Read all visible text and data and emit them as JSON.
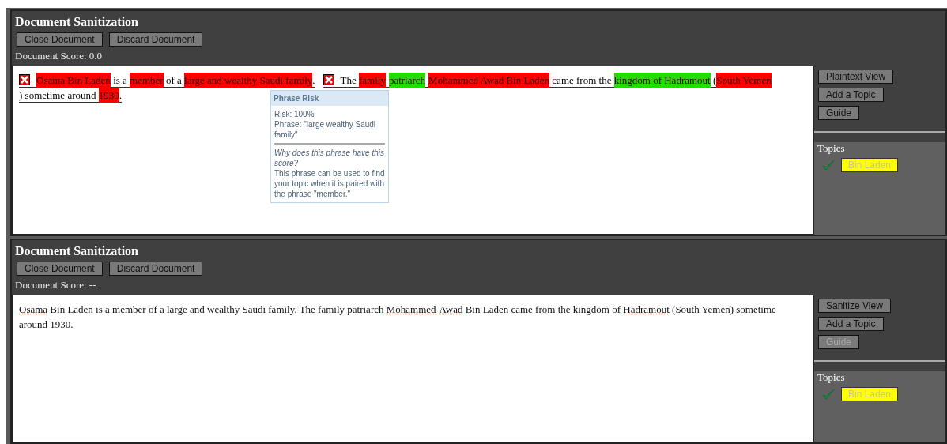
{
  "panels": [
    {
      "title": "Document Sanitization",
      "buttons": [
        {
          "label": "Close Document"
        },
        {
          "label": "Discard Document"
        }
      ],
      "score": "Document Score: 0.0",
      "document": {
        "kind": "highlighted",
        "sentences": [
          {
            "removable": true,
            "segments": [
              {
                "text": "Osama Bin Laden",
                "color": "#ff0000"
              },
              {
                "text": " is a "
              },
              {
                "text": "member",
                "color": "#ff0000"
              },
              {
                "text": " of a "
              },
              {
                "text": "large and wealthy Saudi family",
                "color": "#ff0000"
              },
              {
                "text": "."
              }
            ]
          },
          {
            "removable": true,
            "segments": [
              {
                "text": "The "
              },
              {
                "text": "family",
                "color": "#ff0000",
                "gap_after": true
              },
              {
                "text": "patriarch",
                "color": "#22dd00",
                "gap_after": true
              },
              {
                "text": "Mohammed Awad Bin Laden",
                "color": "#ff0000"
              },
              {
                "text": " came from the "
              },
              {
                "text": "kingdom of Hadramout",
                "color": "#22dd00"
              },
              {
                "text": " ("
              },
              {
                "text": "South Yemen",
                "color": "#ff0000"
              },
              {
                "text": ") sometime around "
              },
              {
                "text": "1930",
                "color": "#ff0000"
              },
              {
                "text": "."
              }
            ]
          }
        ],
        "tooltip": {
          "title": "Phrase Risk",
          "lines": [
            "Risk: 100%",
            "Phrase: \"large wealthy Saudi family\""
          ],
          "question": "Why does this phrase have this score?",
          "explanation": "This phrase can be used to find your topic when it is paired with the phrase \"member.\""
        }
      },
      "side_buttons": [
        {
          "label": "Plaintext View",
          "disabled": false
        },
        {
          "label": "Add a Topic",
          "disabled": false
        },
        {
          "label": "Guide",
          "disabled": false
        }
      ],
      "topics_label": "Topics",
      "topics": [
        {
          "label": "Bin Laden",
          "checked": true
        }
      ]
    },
    {
      "title": "Document Sanitization",
      "buttons": [
        {
          "label": "Close Document"
        },
        {
          "label": "Discard Document"
        }
      ],
      "score": "Document Score: --",
      "document": {
        "kind": "plain",
        "segments": [
          {
            "text": "Osama",
            "misspelled": true
          },
          {
            "text": " Bin Laden is a member of a large and wealthy Saudi family. The family patriarch ",
            "misspelled": false
          },
          {
            "text": "Mohammed",
            "misspelled": true,
            "gap_after": true
          },
          {
            "text": "Awad",
            "misspelled": true
          },
          {
            "text": " Bin Laden came from the kingdom of ",
            "misspelled": false
          },
          {
            "text": "Hadramout",
            "misspelled": true
          },
          {
            "text": " (South Yemen) sometime around 1930.",
            "misspelled": false
          }
        ]
      },
      "side_buttons": [
        {
          "label": "Sanitize View",
          "disabled": false
        },
        {
          "label": "Add a Topic",
          "disabled": false
        },
        {
          "label": "Guide",
          "disabled": true
        }
      ],
      "topics_label": "Topics",
      "topics": [
        {
          "label": "Bin Laden",
          "checked": true
        }
      ]
    }
  ]
}
